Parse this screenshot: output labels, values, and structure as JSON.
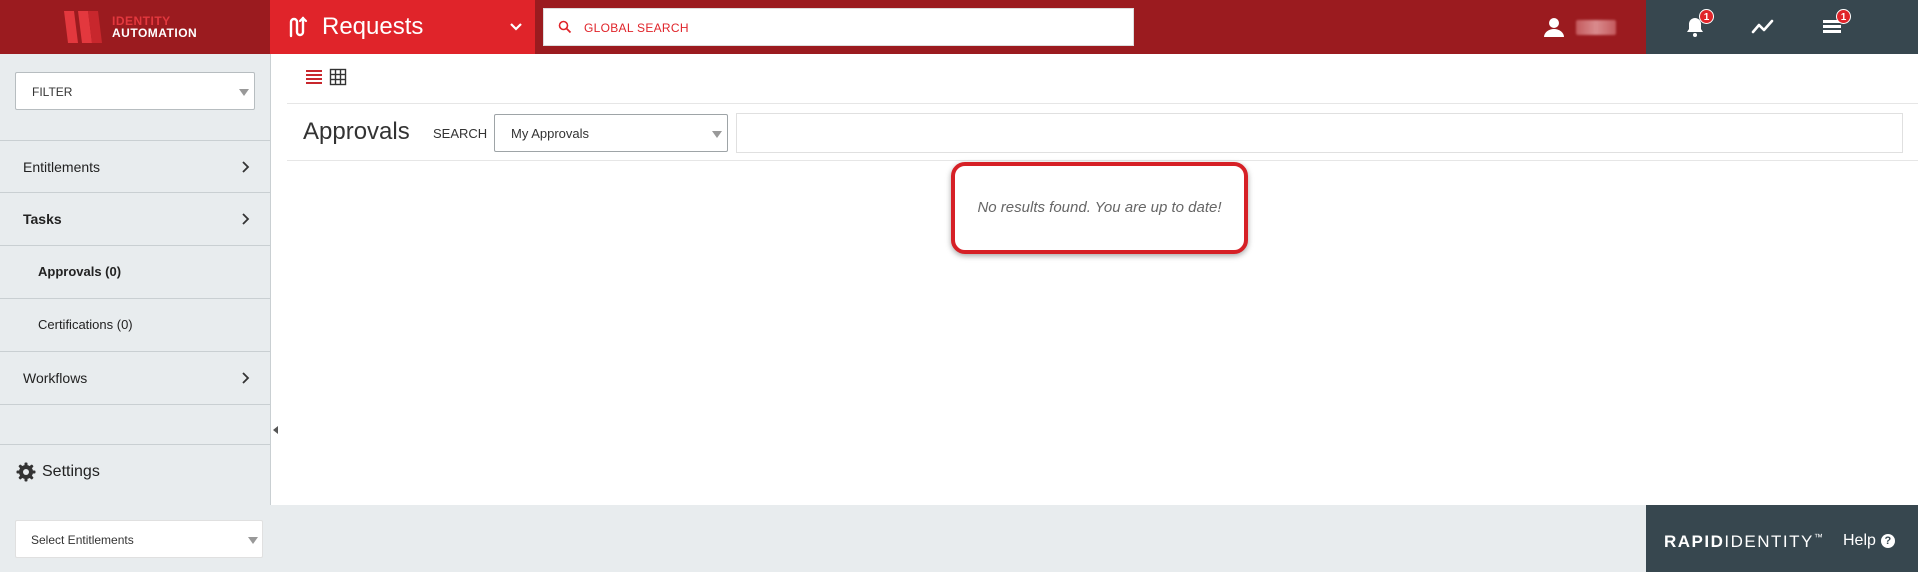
{
  "header": {
    "logo_line1": "IDENTITY",
    "logo_line2": "AUTOMATION",
    "module_title": "Requests",
    "global_search_placeholder": "GLOBAL SEARCH",
    "notifications_count": "1",
    "tasks_count": "1"
  },
  "sidebar": {
    "filter_label": "FILTER",
    "items": [
      {
        "label": "Entitlements"
      },
      {
        "label": "Tasks"
      },
      {
        "label": "Approvals (0)"
      },
      {
        "label": "Certifications (0)"
      },
      {
        "label": "Workflows"
      }
    ],
    "settings_label": "Settings"
  },
  "main": {
    "title": "Approvals",
    "search_label": "SEARCH",
    "search_scope": "My Approvals",
    "empty_message": "No results found. You are up to date!"
  },
  "footer": {
    "entitlements_select": "Select Entitlements",
    "brand_rapid": "RAPID",
    "brand_identity": "IDENTITY",
    "brand_tm": "™",
    "help_label": "Help",
    "help_icon_glyph": "?"
  },
  "colors": {
    "header_dark_red": "#9b1b1f",
    "accent_red": "#e0242a",
    "slate": "#37474f",
    "sidebar_bg": "#e8ecee"
  }
}
